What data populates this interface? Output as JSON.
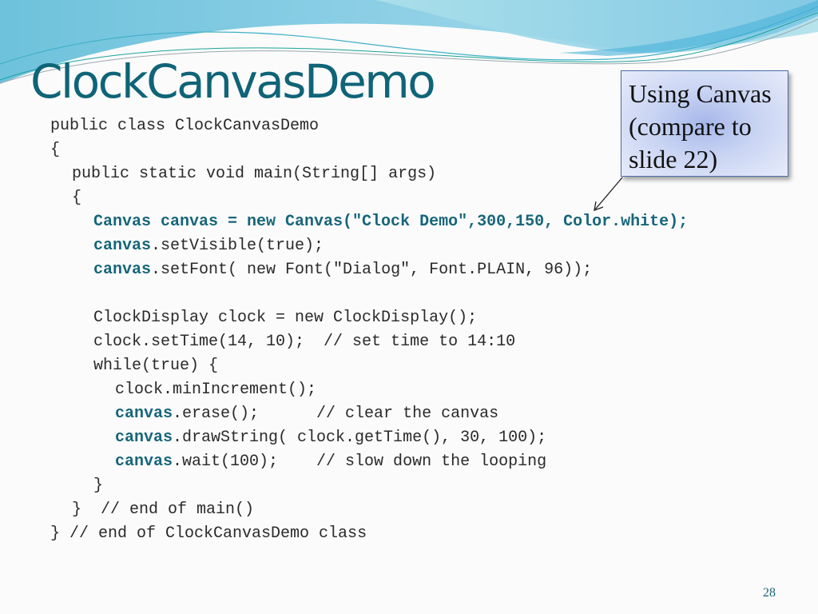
{
  "slide": {
    "title": "ClockCanvasDemo",
    "page_number": "28",
    "callout": {
      "lines": [
        "Using Canvas",
        "(compare to",
        "slide 22)"
      ]
    },
    "code": [
      {
        "indent": 0,
        "parts": [
          {
            "text": "public class ClockCanvasDemo",
            "bold": false
          }
        ]
      },
      {
        "indent": 0,
        "parts": [
          {
            "text": "{",
            "bold": false
          }
        ]
      },
      {
        "indent": 1,
        "parts": [
          {
            "text": "public static void main(String[] args)",
            "bold": false
          }
        ]
      },
      {
        "indent": 1,
        "parts": [
          {
            "text": "{",
            "bold": false
          }
        ]
      },
      {
        "indent": 2,
        "parts": [
          {
            "text": "Canvas canvas = new Canvas(\"Clock Demo\",300,150, Color.white);",
            "bold": true
          }
        ]
      },
      {
        "indent": 2,
        "parts": [
          {
            "text": "canvas",
            "bold": true
          },
          {
            "text": ".setVisible(true);",
            "bold": false
          }
        ]
      },
      {
        "indent": 2,
        "parts": [
          {
            "text": "canvas",
            "bold": true
          },
          {
            "text": ".setFont( new Font(\"Dialog\", Font.PLAIN, 96));",
            "bold": false
          }
        ]
      },
      {
        "indent": 0,
        "parts": [
          {
            "text": "",
            "bold": false
          }
        ]
      },
      {
        "indent": 2,
        "parts": [
          {
            "text": "ClockDisplay clock = new ClockDisplay();",
            "bold": false
          }
        ]
      },
      {
        "indent": 2,
        "parts": [
          {
            "text": "clock.setTime(14, 10);  // set time to 14:10",
            "bold": false
          }
        ]
      },
      {
        "indent": 2,
        "parts": [
          {
            "text": "while(true) {",
            "bold": false
          }
        ]
      },
      {
        "indent": 3,
        "parts": [
          {
            "text": "clock.minIncrement();",
            "bold": false
          }
        ]
      },
      {
        "indent": 3,
        "parts": [
          {
            "text": "canvas",
            "bold": true
          },
          {
            "text": ".erase();      // clear the canvas",
            "bold": false
          }
        ]
      },
      {
        "indent": 3,
        "parts": [
          {
            "text": "canvas",
            "bold": true
          },
          {
            "text": ".drawString( clock.getTime(), 30, 100);",
            "bold": false
          }
        ]
      },
      {
        "indent": 3,
        "parts": [
          {
            "text": "canvas",
            "bold": true
          },
          {
            "text": ".wait(100);    // slow down the looping",
            "bold": false
          }
        ]
      },
      {
        "indent": 2,
        "parts": [
          {
            "text": "}",
            "bold": false
          }
        ]
      },
      {
        "indent": 1,
        "parts": [
          {
            "text": "}  // end of main()",
            "bold": false
          }
        ]
      },
      {
        "indent": 0,
        "parts": [
          {
            "text": "} // end of ClockCanvasDemo class",
            "bold": false
          }
        ]
      }
    ]
  },
  "colors": {
    "title": "#0f6477",
    "keyword": "#17667a",
    "code_text": "#2a2a2a",
    "callout_border": "#4a6fa6"
  }
}
